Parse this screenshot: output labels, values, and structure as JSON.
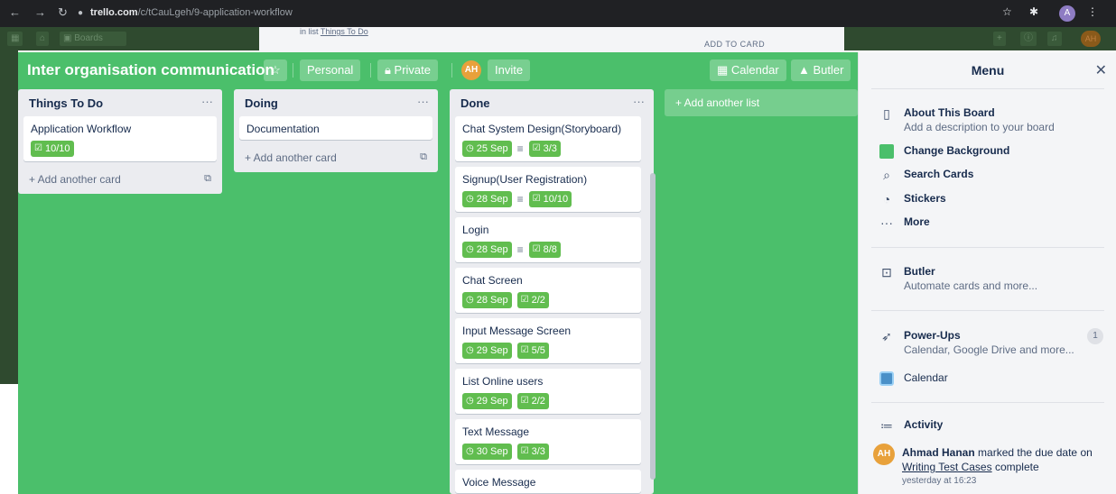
{
  "browser": {
    "url_host": "trello.com",
    "url_path": "/c/tCauLgeh/9-application-workflow",
    "profile_initial": "A"
  },
  "background": {
    "boards_label": "Boards",
    "member_initials": "AH",
    "modal_in_list_prefix": "in list",
    "modal_in_list_name": "Things To Do",
    "modal_add_to_card": "ADD TO CARD"
  },
  "board": {
    "title": "Inter organisation communication",
    "visibility_team": "Personal",
    "visibility_privacy": "Private",
    "member_initials": "AH",
    "invite_label": "Invite",
    "calendar_label": "Calendar",
    "butler_label": "Butler",
    "add_list_label": "+ Add another list"
  },
  "lists": [
    {
      "title": "Things To Do",
      "cards": [
        {
          "title": "Application Workflow",
          "checklist": "10/10"
        }
      ],
      "add_card": "+ Add another card"
    },
    {
      "title": "Doing",
      "cards": [
        {
          "title": "Documentation"
        }
      ],
      "add_card": "+ Add another card"
    },
    {
      "title": "Done",
      "cards": [
        {
          "title": "Chat System Design(Storyboard)",
          "due": "25 Sep",
          "has_description": true,
          "checklist": "3/3"
        },
        {
          "title": "Signup(User Registration)",
          "due": "28 Sep",
          "has_description": true,
          "checklist": "10/10"
        },
        {
          "title": "Login",
          "due": "28 Sep",
          "has_description": true,
          "checklist": "8/8"
        },
        {
          "title": "Chat Screen",
          "due": "28 Sep",
          "checklist": "2/2"
        },
        {
          "title": "Input Message Screen",
          "due": "29 Sep",
          "checklist": "5/5"
        },
        {
          "title": "List Online users",
          "due": "29 Sep",
          "checklist": "2/2"
        },
        {
          "title": "Text Message",
          "due": "30 Sep",
          "checklist": "3/3"
        },
        {
          "title": "Voice Message"
        }
      ]
    }
  ],
  "menu": {
    "title": "Menu",
    "about_title": "About This Board",
    "about_sub": "Add a description to your board",
    "change_background": "Change Background",
    "search_cards": "Search Cards",
    "stickers": "Stickers",
    "more": "More",
    "butler_title": "Butler",
    "butler_sub": "Automate cards and more...",
    "powerups_title": "Power-Ups",
    "powerups_sub": "Calendar, Google Drive and more...",
    "powerups_count": "1",
    "calendar": "Calendar",
    "activity_title": "Activity",
    "activity_user": "Ahmad Hanan",
    "activity_initials": "AH",
    "activity_action": "marked the due date on",
    "activity_card": "Writing Test Cases",
    "activity_suffix": "complete",
    "activity_time": "yesterday at 16:23"
  },
  "colors": {
    "board_green": "#4bbf6b",
    "badge_green": "#61bd4f",
    "member_orange": "#e8a13b"
  }
}
